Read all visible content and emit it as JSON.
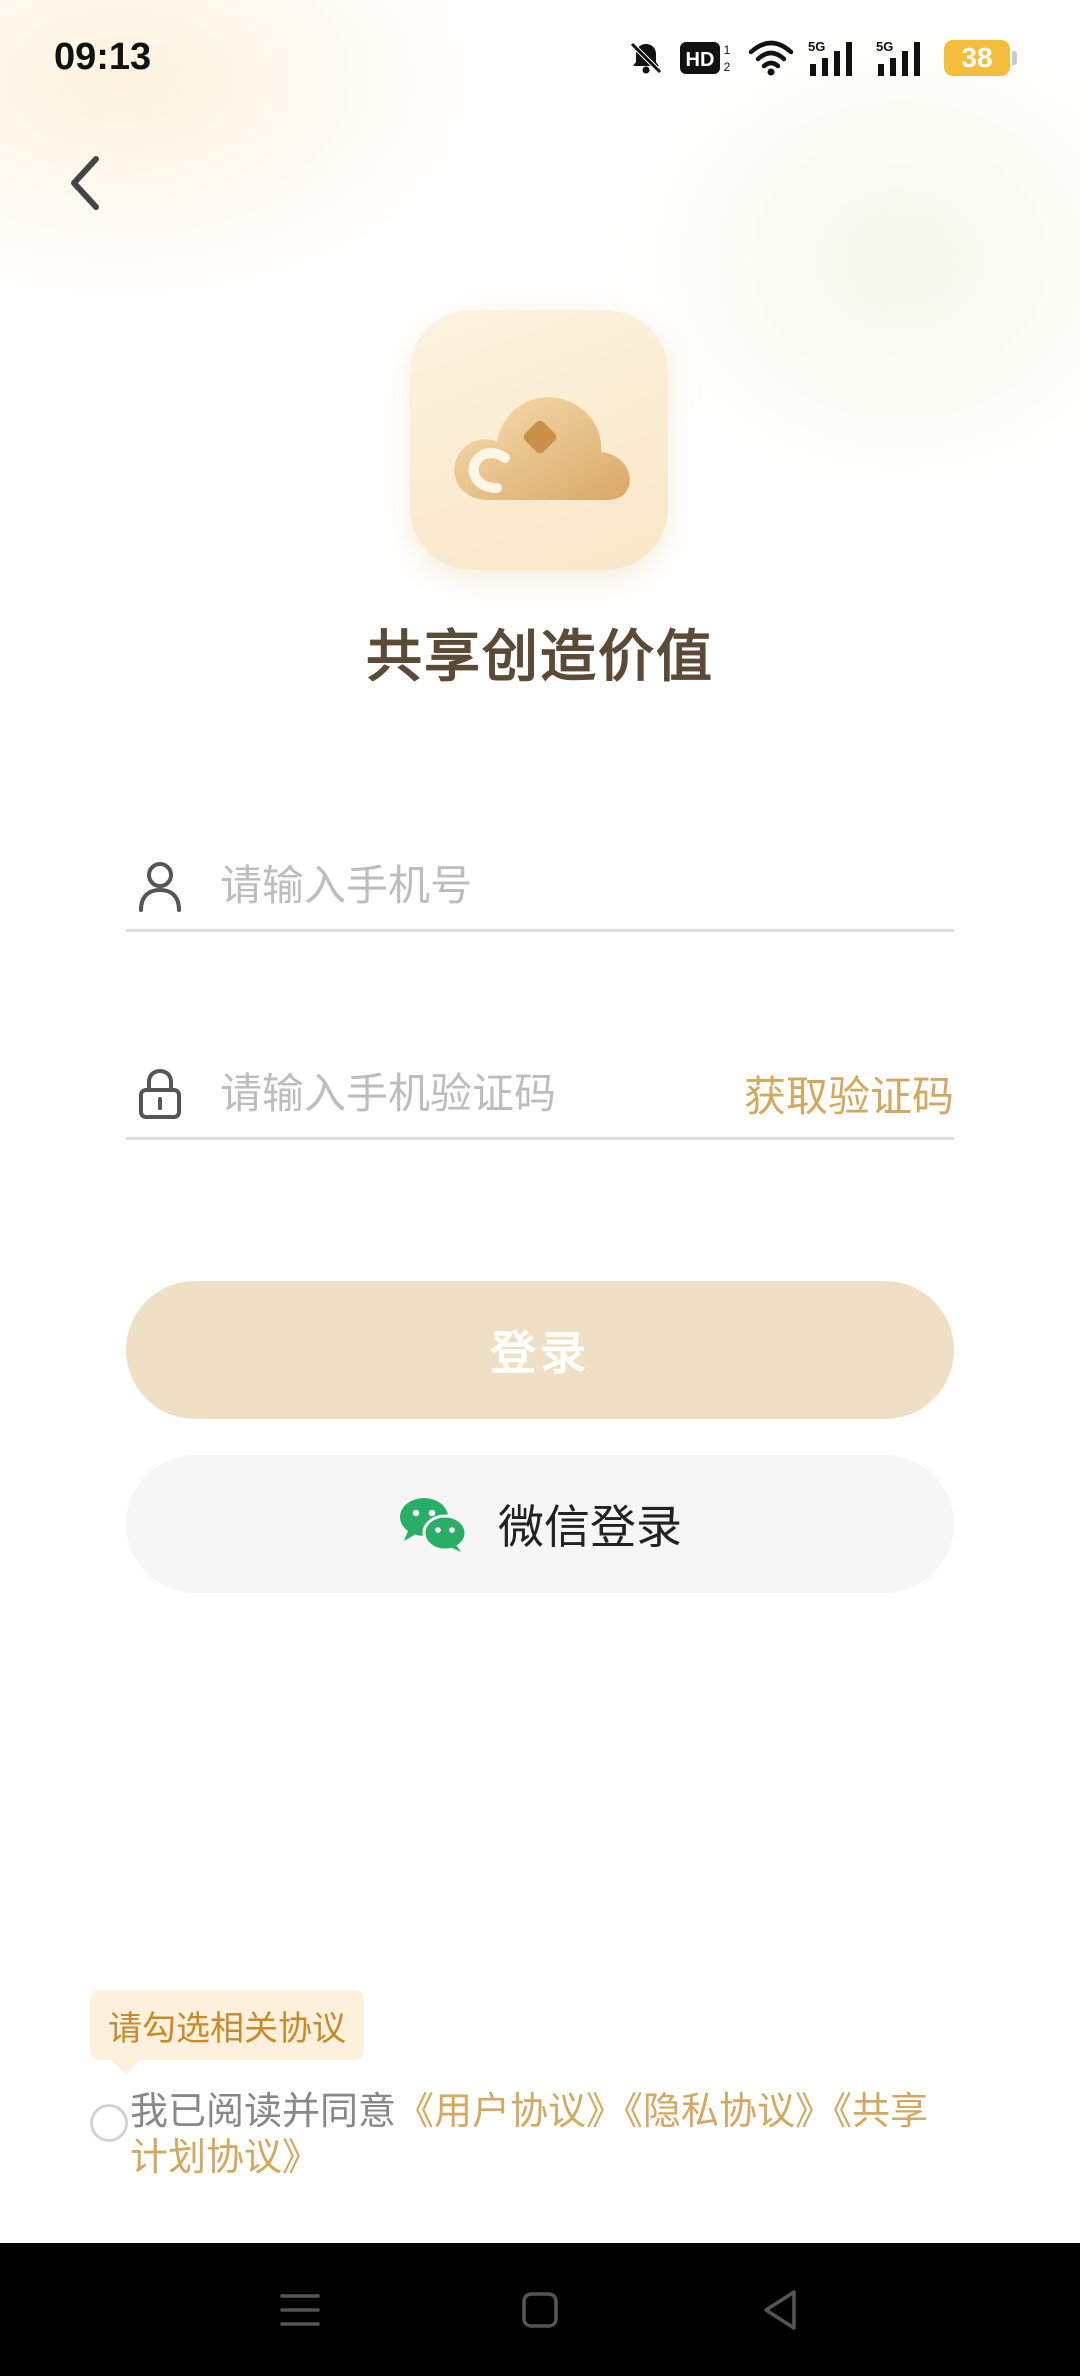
{
  "status_bar": {
    "time": "09:13",
    "battery": "38",
    "icons": [
      "mute-bell-icon",
      "hd-icon",
      "wifi-icon",
      "5g-signal-icon",
      "5g-signal-icon",
      "battery-icon"
    ]
  },
  "header": {
    "back_icon": "chevron-left-icon"
  },
  "brand": {
    "logo_icon": "cloud-icon",
    "slogan": "共享创造价值"
  },
  "form": {
    "phone_placeholder": "请输入手机号",
    "phone_value": "",
    "code_placeholder": "请输入手机验证码",
    "code_value": "",
    "get_code_label": "获取验证码"
  },
  "actions": {
    "login_label": "登录",
    "wechat_login_label": "微信登录"
  },
  "agreement": {
    "tooltip": "请勾选相关协议",
    "prefix": "我已阅读并同意",
    "user_agreement": "《用户协议》",
    "privacy_agreement": "《隐私协议》",
    "share_plan_agreement": "《共享计划协议》",
    "checked": false
  },
  "colors": {
    "accent": "#d3a860",
    "login_button": "#eedfc5",
    "wechat_green": "#2aae67",
    "battery": "#f5bd3c"
  }
}
